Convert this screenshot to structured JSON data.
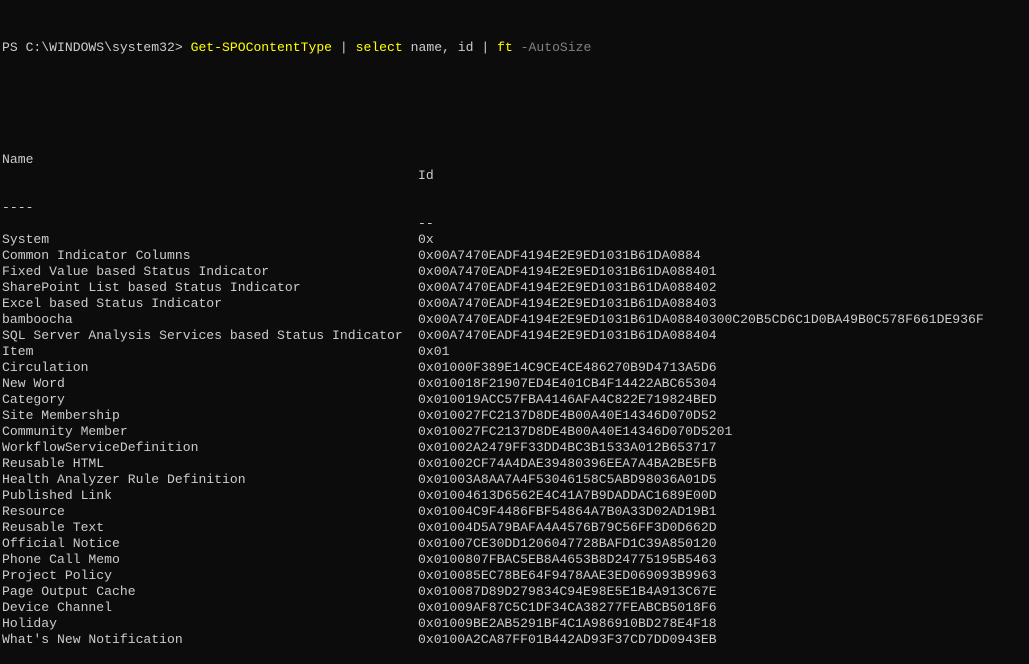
{
  "prompt": {
    "path": "PS C:\\WINDOWS\\system32> ",
    "cmdlet": "Get-SPOContentType",
    "pipe1": " | ",
    "select": "select",
    "select_args": " name, id",
    "pipe2": " | ",
    "ft": "ft",
    "space": " ",
    "ft_param": "-AutoSize"
  },
  "headers": {
    "name": "Name",
    "id": "Id"
  },
  "underline": {
    "name": "----",
    "id": "--"
  },
  "rows": [
    {
      "name": "System",
      "id": "0x"
    },
    {
      "name": "Common Indicator Columns",
      "id": "0x00A7470EADF4194E2E9ED1031B61DA0884"
    },
    {
      "name": "Fixed Value based Status Indicator",
      "id": "0x00A7470EADF4194E2E9ED1031B61DA088401"
    },
    {
      "name": "SharePoint List based Status Indicator",
      "id": "0x00A7470EADF4194E2E9ED1031B61DA088402"
    },
    {
      "name": "Excel based Status Indicator",
      "id": "0x00A7470EADF4194E2E9ED1031B61DA088403"
    },
    {
      "name": "bamboocha",
      "id": "0x00A7470EADF4194E2E9ED1031B61DA08840300C20B5CD6C1D0BA49B0C578F661DE936F"
    },
    {
      "name": "SQL Server Analysis Services based Status Indicator",
      "id": "0x00A7470EADF4194E2E9ED1031B61DA088404"
    },
    {
      "name": "Item",
      "id": "0x01"
    },
    {
      "name": "Circulation",
      "id": "0x01000F389E14C9CE4CE486270B9D4713A5D6"
    },
    {
      "name": "New Word",
      "id": "0x010018F21907ED4E401CB4F14422ABC65304"
    },
    {
      "name": "Category",
      "id": "0x010019ACC57FBA4146AFA4C822E719824BED"
    },
    {
      "name": "Site Membership",
      "id": "0x010027FC2137D8DE4B00A40E14346D070D52"
    },
    {
      "name": "Community Member",
      "id": "0x010027FC2137D8DE4B00A40E14346D070D5201"
    },
    {
      "name": "WorkflowServiceDefinition",
      "id": "0x01002A2479FF33DD4BC3B1533A012B653717"
    },
    {
      "name": "Reusable HTML",
      "id": "0x01002CF74A4DAE39480396EEA7A4BA2BE5FB"
    },
    {
      "name": "Health Analyzer Rule Definition",
      "id": "0x01003A8AA7A4F53046158C5ABD98036A01D5"
    },
    {
      "name": "Published Link",
      "id": "0x01004613D6562E4C41A7B9DADDAC1689E00D"
    },
    {
      "name": "Resource",
      "id": "0x01004C9F4486FBF54864A7B0A33D02AD19B1"
    },
    {
      "name": "Reusable Text",
      "id": "0x01004D5A79BAFA4A4576B79C56FF3D0D662D"
    },
    {
      "name": "Official Notice",
      "id": "0x01007CE30DD1206047728BAFD1C39A850120"
    },
    {
      "name": "Phone Call Memo",
      "id": "0x0100807FBAC5EB8A4653B8D24775195B5463"
    },
    {
      "name": "Project Policy",
      "id": "0x010085EC78BE64F9478AAE3ED069093B9963"
    },
    {
      "name": "Page Output Cache",
      "id": "0x010087D89D279834C94E98E5E1B4A913C67E"
    },
    {
      "name": "Device Channel",
      "id": "0x01009AF87C5C1DF34CA38277FEABCB5018F6"
    },
    {
      "name": "Holiday",
      "id": "0x01009BE2AB5291BF4C1A986910BD278E4F18"
    },
    {
      "name": "What's New Notification",
      "id": "0x0100A2CA87FF01B442AD93F37CD7DD0943EB"
    }
  ]
}
